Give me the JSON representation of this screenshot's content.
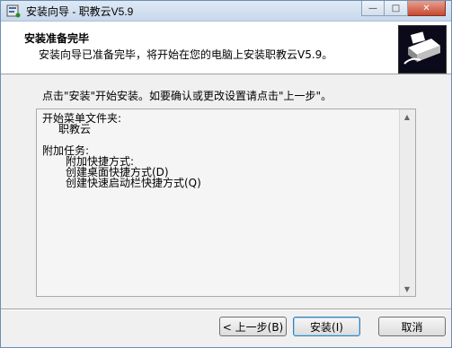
{
  "window": {
    "title": "安装向导 - 职教云V5.9",
    "controls": {
      "minimize": "—",
      "maximize": "□",
      "close": "✕"
    }
  },
  "header": {
    "title": "安装准备完毕",
    "subtitle": "安装向导已准备完毕，将开始在您的电脑上安装职教云V5.9。"
  },
  "body": {
    "instruction": "点击\"安装\"开始安装。如要确认或更改设置请点击\"上一步\"。"
  },
  "memo": {
    "lines": [
      {
        "text": "开始菜单文件夹:",
        "indent": 0
      },
      {
        "text": "职教云",
        "indent": 1
      },
      {
        "text": "",
        "indent": 0
      },
      {
        "text": "附加任务:",
        "indent": 0
      },
      {
        "text": "附加快捷方式:",
        "indent": 2
      },
      {
        "text": "创建桌面快捷方式(D)",
        "indent": 3
      },
      {
        "text": "创建快速启动栏快捷方式(Q)",
        "indent": 3
      }
    ]
  },
  "buttons": {
    "back": "< 上一步(B)",
    "install": "安装(I)",
    "cancel": "取消"
  },
  "colors": {
    "titlebar": "#c7d8ec",
    "dialog_bg": "#f0f0f0",
    "close_button": "#c74a32"
  }
}
